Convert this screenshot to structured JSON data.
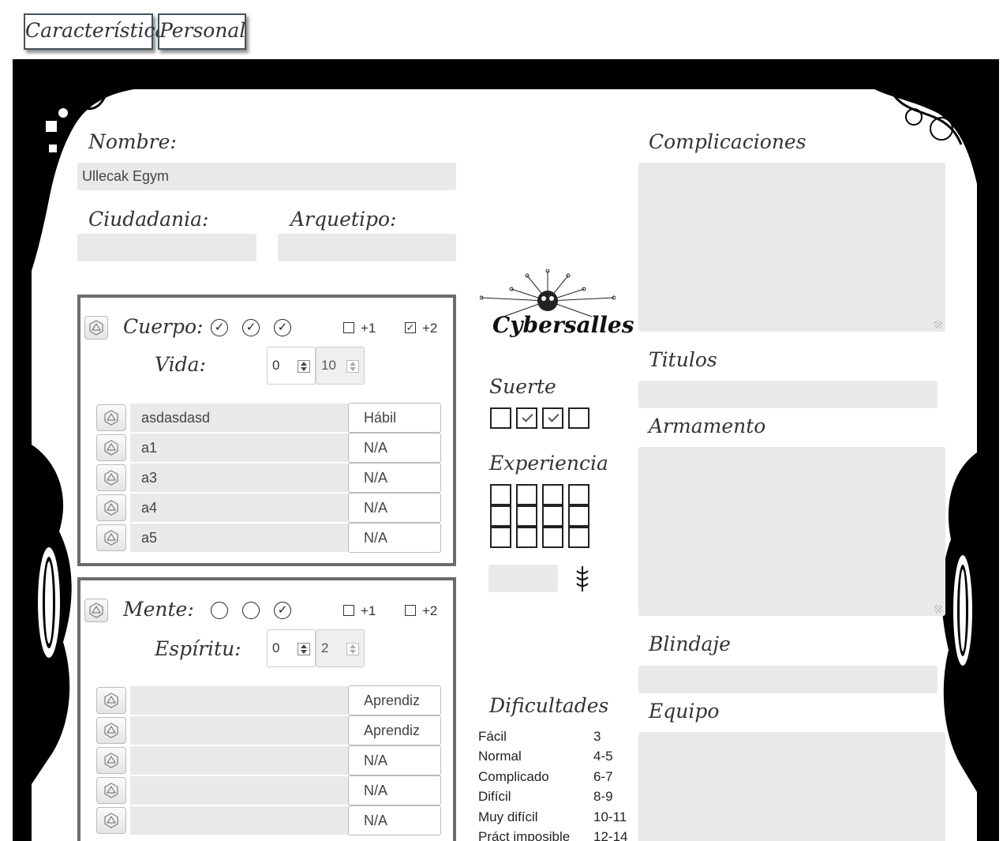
{
  "tabs": [
    {
      "label": "Características"
    },
    {
      "label": "Personal"
    }
  ],
  "fields": {
    "nombre_label": "Nombre:",
    "nombre_value": "Ullecak Egym",
    "ciudadania_label": "Ciudadania:",
    "ciudadania_value": "",
    "arquetipo_label": "Arquetipo:",
    "arquetipo_value": ""
  },
  "cuerpo": {
    "label": "Cuerpo:",
    "marks": [
      "✓",
      "✓",
      "✓"
    ],
    "bonus1": {
      "label": "+1",
      "checked": false
    },
    "bonus2": {
      "label": "+2",
      "checked": true
    },
    "pool_label": "Vida:",
    "pool_current": "0",
    "pool_max": "10",
    "skills": [
      {
        "name": "asdasdasd",
        "level": "Hábil"
      },
      {
        "name": "a1",
        "level": "N/A"
      },
      {
        "name": "a3",
        "level": "N/A"
      },
      {
        "name": "a4",
        "level": "N/A"
      },
      {
        "name": "a5",
        "level": "N/A"
      }
    ]
  },
  "mente": {
    "label": "Mente:",
    "marks": [
      "",
      "",
      "✓"
    ],
    "bonus1": {
      "label": "+1",
      "checked": false
    },
    "bonus2": {
      "label": "+2",
      "checked": false
    },
    "pool_label": "Espíritu:",
    "pool_current": "0",
    "pool_max": "2",
    "skills": [
      {
        "name": "",
        "level": "Aprendiz"
      },
      {
        "name": "",
        "level": "Aprendiz"
      },
      {
        "name": "",
        "level": "N/A"
      },
      {
        "name": "",
        "level": "N/A"
      },
      {
        "name": "",
        "level": "N/A"
      }
    ]
  },
  "logo": {
    "text": "Cybersalles"
  },
  "suerte": {
    "label": "Suerte",
    "boxes": [
      false,
      true,
      true,
      false
    ]
  },
  "experiencia": {
    "label": "Experiencia",
    "boxes": 12,
    "value": ""
  },
  "dificultades": {
    "label": "Dificultades",
    "rows": [
      {
        "name": "Fácil",
        "value": "3"
      },
      {
        "name": "Normal",
        "value": "4-5"
      },
      {
        "name": "Complicado",
        "value": "6-7"
      },
      {
        "name": "Difícil",
        "value": "8-9"
      },
      {
        "name": "Muy difícil",
        "value": "10-11"
      },
      {
        "name": "Práct imposible",
        "value": "12-14"
      }
    ]
  },
  "right": {
    "complicaciones_label": "Complicaciones",
    "titulos_label": "Titulos",
    "armamento_label": "Armamento",
    "blindaje_label": "Blindaje",
    "equipo_label": "Equipo"
  }
}
